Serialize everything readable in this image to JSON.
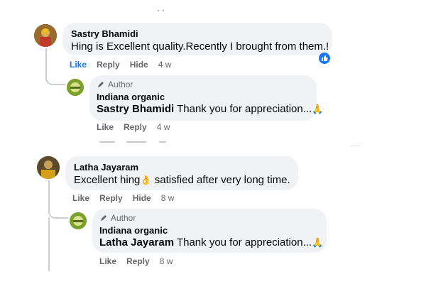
{
  "comments": [
    {
      "author": "Sastry Bhamidi",
      "text": "Hing is Excellent quality.Recently I brought from them.!",
      "actions": {
        "like": "Like",
        "reply": "Reply",
        "hide": "Hide",
        "time": "4 w"
      },
      "reaction_icon": "like-thumb-icon",
      "reply": {
        "badge": "Author",
        "page_name": "Indiana organic",
        "mention": "Sastry Bhamidi",
        "text": " Thank you for appreciation...",
        "emoji": "🙏",
        "actions": {
          "like": "Like",
          "reply": "Reply",
          "time": "4 w"
        }
      }
    },
    {
      "author": "Latha Jayaram",
      "text_before": "Excellent hing",
      "emoji": "👌",
      "text_after": " satisfied after very long time.",
      "actions": {
        "like": "Like",
        "reply": "Reply",
        "hide": "Hide",
        "time": "8 w"
      },
      "reply": {
        "badge": "Author",
        "page_name": "Indiana organic",
        "mention": "Latha Jayaram",
        "text": " Thank you for appreciation...",
        "emoji": "🙏",
        "actions": {
          "like": "Like",
          "reply": "Reply",
          "time": "8 w"
        }
      }
    }
  ],
  "colors": {
    "link_blue": "#1877f2",
    "bubble_bg": "#f0f2f5",
    "meta_gray": "#65676b"
  }
}
